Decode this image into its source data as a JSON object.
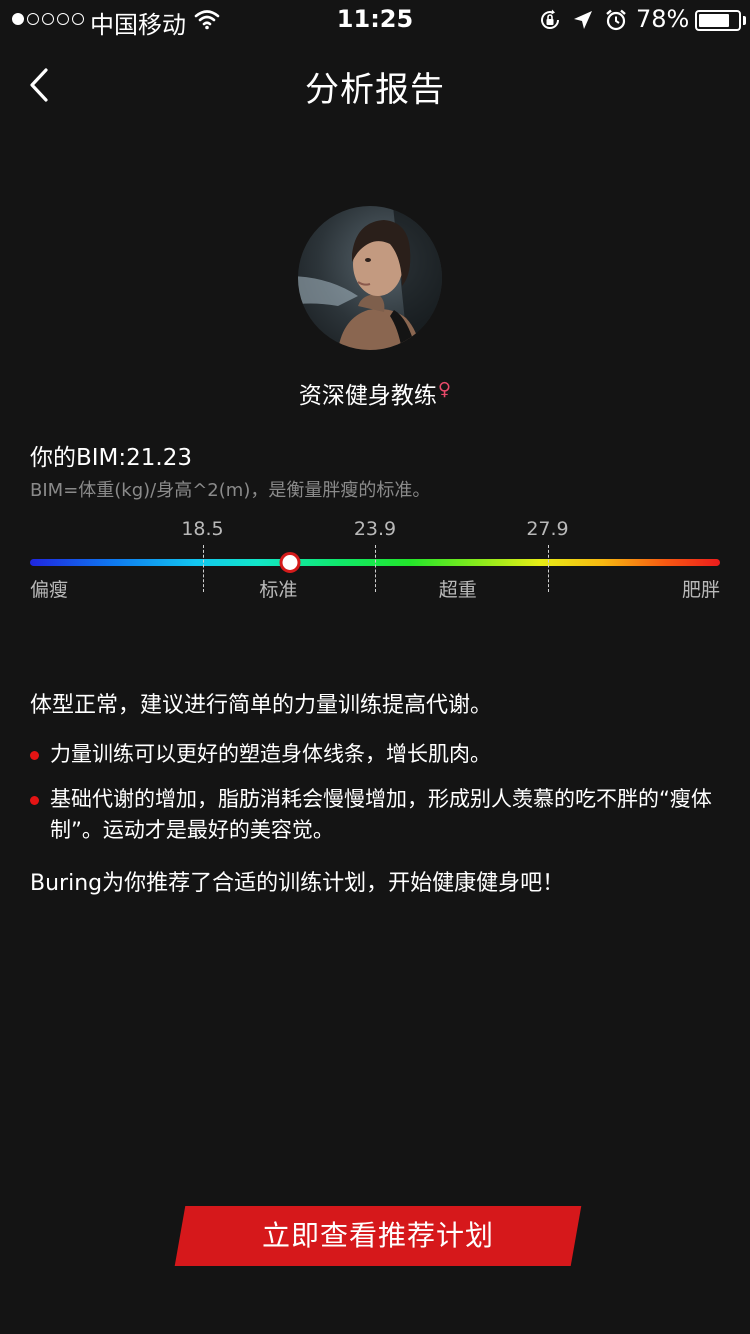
{
  "status_bar": {
    "carrier": "中国移动",
    "time": "11:25",
    "battery": "78%",
    "battery_level": 0.78,
    "signal_bars_filled": 1,
    "signal_bars_total": 5
  },
  "nav": {
    "title": "分析报告",
    "back_icon": "chevron-left-icon"
  },
  "coach": {
    "title": "资深健身教练",
    "gender_symbol": "♀"
  },
  "bmi": {
    "value_text": "你的BIM:21.23",
    "value": 21.23,
    "formula": "BIM=体重(kg)/身高^2(m)，是衡量胖瘦的标准。",
    "thresholds": [
      "18.5",
      "23.9",
      "27.9"
    ],
    "categories": [
      "偏瘦",
      "标准",
      "超重",
      "肥胖"
    ]
  },
  "analysis": {
    "summary": "体型正常，建议进行简单的力量训练提高代谢。",
    "bullets": [
      "力量训练可以更好的塑造身体线条，增长肌肉。",
      "基础代谢的增加，脂肪消耗会慢慢增加，形成别人羡慕的吃不胖的“瘦体制”。运动才是最好的美容觉。"
    ],
    "recommendation": "Buring为你推荐了合适的训练计划，开始健康健身吧！"
  },
  "cta": {
    "label": "立即查看推荐计划"
  },
  "colors": {
    "background": "#141414",
    "accent": "#d6181b",
    "muted_text": "#8a8a8a"
  }
}
